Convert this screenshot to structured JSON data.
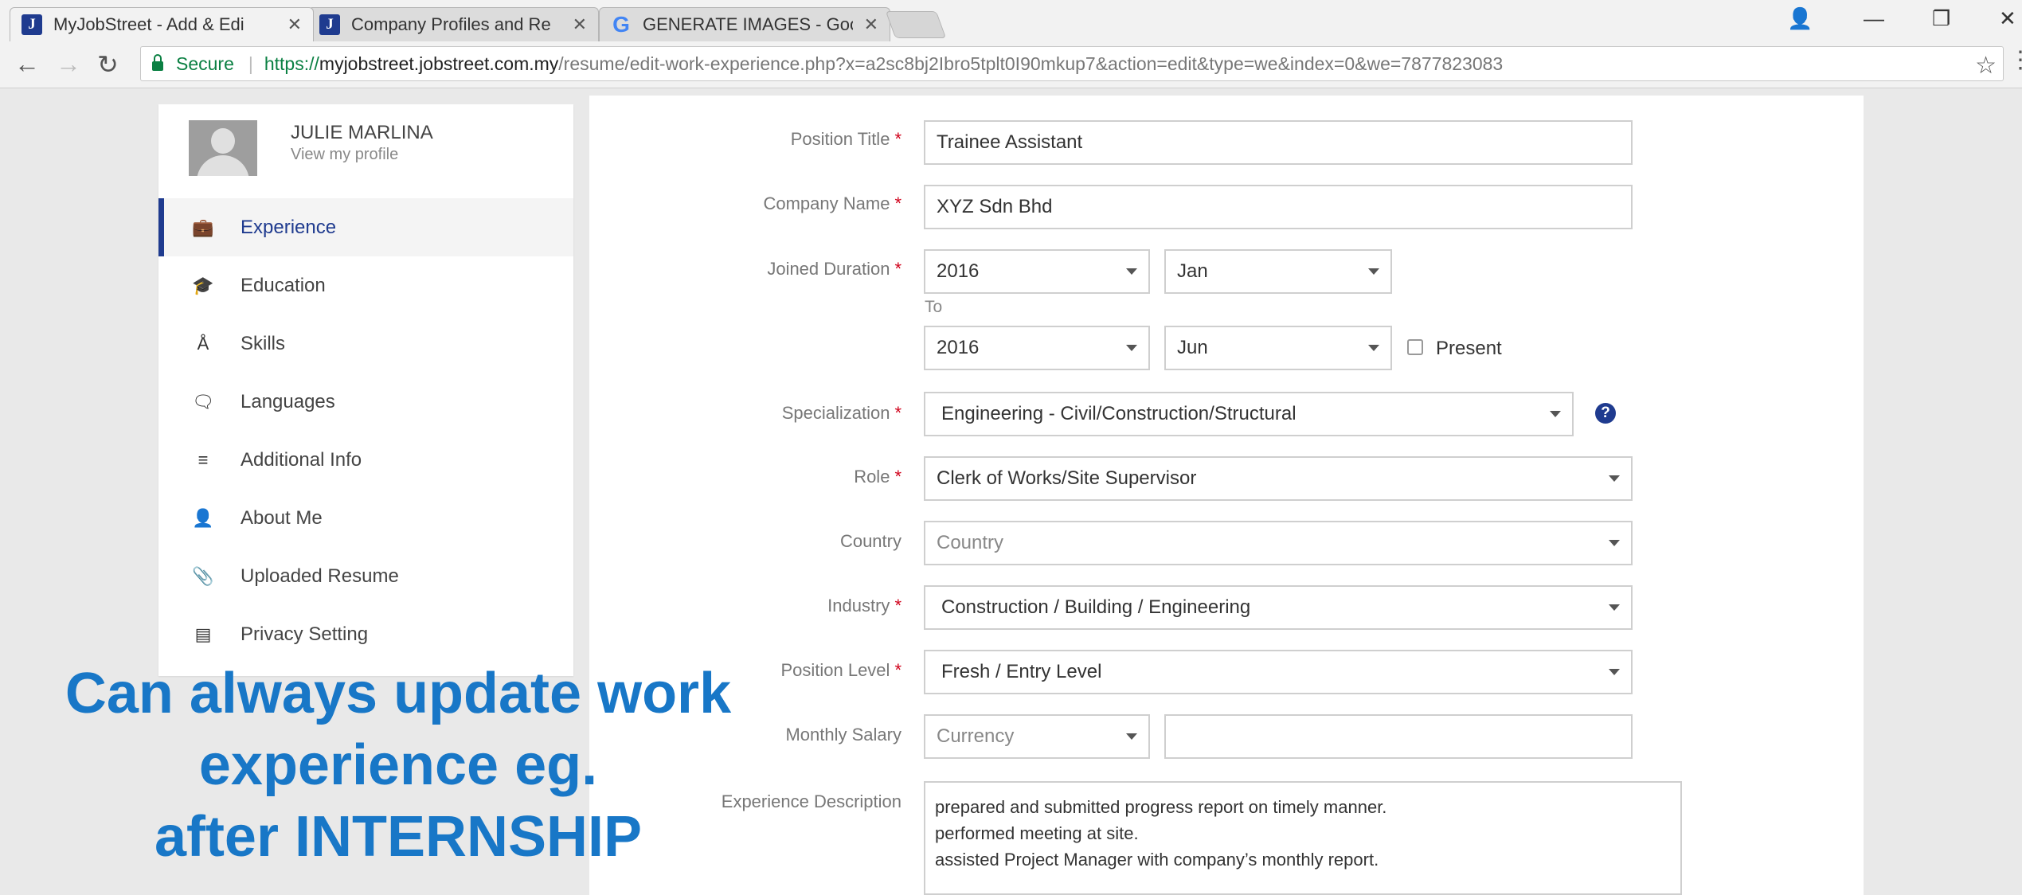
{
  "browser": {
    "tabs": [
      {
        "label": "MyJobStreet - Add & Edi",
        "icon": "jobstreet-favicon-icon",
        "active": true
      },
      {
        "label": "Company Profiles and Re",
        "icon": "jobstreet-favicon-icon",
        "active": false
      },
      {
        "label": "GENERATE IMAGES - Goo",
        "icon": "google-favicon-icon",
        "active": false
      }
    ],
    "favicon_letter": "J",
    "google_letter": "G",
    "secure_label": "Secure",
    "url_scheme": "https://",
    "url_host": "myjobstreet.jobstreet.com.my",
    "url_path": "/resume/edit-work-experience.php?x=a2sc8bj2Ibro5tplt0I90mkup7&action=edit&type=we&index=0&we=7877823083"
  },
  "profile": {
    "name": "JULIE MARLINA",
    "view_link": "View my profile"
  },
  "sidebar": {
    "items": [
      {
        "label": "Experience",
        "icon": "briefcase-icon",
        "glyph": "💼",
        "active": true
      },
      {
        "label": "Education",
        "icon": "graduation-cap-icon",
        "glyph": "🎓",
        "active": false
      },
      {
        "label": "Skills",
        "icon": "compass-icon",
        "glyph": "Å",
        "active": false
      },
      {
        "label": "Languages",
        "icon": "chat-bubbles-icon",
        "glyph": "🗨",
        "active": false
      },
      {
        "label": "Additional Info",
        "icon": "list-icon",
        "glyph": "≡",
        "active": false
      },
      {
        "label": "About Me",
        "icon": "user-icon",
        "glyph": "👤",
        "active": false
      },
      {
        "label": "Uploaded Resume",
        "icon": "paperclip-icon",
        "glyph": "📎",
        "active": false
      },
      {
        "label": "Privacy Setting",
        "icon": "id-card-icon",
        "glyph": "▤",
        "active": false
      }
    ]
  },
  "form": {
    "position_title": {
      "label": "Position Title",
      "value": "Trainee Assistant"
    },
    "company_name": {
      "label": "Company Name",
      "value": "XYZ Sdn Bhd"
    },
    "joined_duration": {
      "label": "Joined Duration",
      "from_year": "2016",
      "from_month": "Jan",
      "to_label": "To",
      "to_year": "2016",
      "to_month": "Jun",
      "present_label": "Present"
    },
    "specialization": {
      "label": "Specialization",
      "value": "Engineering - Civil/Construction/Structural",
      "help": "?"
    },
    "role": {
      "label": "Role",
      "value": "Clerk of Works/Site Supervisor"
    },
    "country": {
      "label": "Country",
      "placeholder": "Country"
    },
    "industry": {
      "label": "Industry",
      "value": "Construction / Building / Engineering"
    },
    "position_level": {
      "label": "Position Level",
      "value": "Fresh / Entry Level"
    },
    "monthly_salary": {
      "label": "Monthly Salary",
      "currency_placeholder": "Currency",
      "amount": ""
    },
    "experience_description": {
      "label": "Experience Description",
      "lines": [
        "prepared and submitted progress report on timely manner.",
        "performed meeting at site.",
        "assisted Project Manager with company’s monthly report."
      ]
    },
    "required_mark": "*"
  },
  "overlay_caption": {
    "lines": [
      "Can always update work",
      "experience eg.",
      "after INTERNSHIP"
    ],
    "color": "#1877c7"
  },
  "colors": {
    "brand": "#1f3b8f",
    "required": "#d0021b",
    "secure": "#0b8043"
  }
}
